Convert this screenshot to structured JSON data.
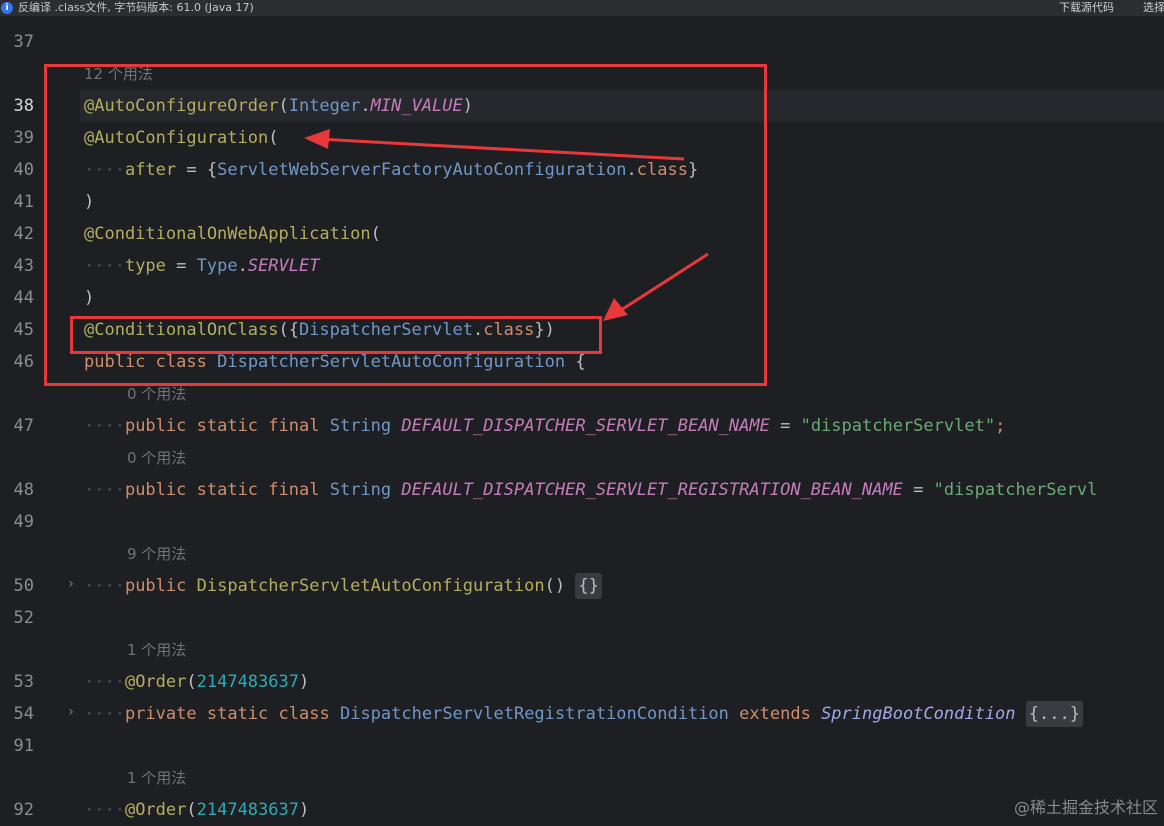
{
  "banner": {
    "message": "反编译 .class文件, 字节码版本: 61.0 (Java 17)",
    "download_source": "下载源代码",
    "choose_source": "选择"
  },
  "editor": {
    "line_numbers": [
      "37",
      "38",
      "39",
      "40",
      "41",
      "42",
      "43",
      "44",
      "45",
      "46",
      "47",
      "48",
      "49",
      "50",
      "52",
      "53",
      "54",
      "91",
      "92"
    ],
    "usages": {
      "l38": "12 个用法",
      "l47": "0 个用法",
      "l48": "0 个用法",
      "l50": "9 个用法",
      "l53": "1 个用法",
      "l92": "1 个用法"
    },
    "tokens": {
      "auto_configure_order": "@AutoConfigureOrder",
      "integer": "Integer",
      "min_value": "MIN_VALUE",
      "auto_configuration": "@AutoConfiguration",
      "after": "after",
      "servlet_web_server_factory": "ServletWebServerFactoryAutoConfiguration",
      "class_kw": "class",
      "conditional_on_web_app": "@ConditionalOnWebApplication",
      "type_param": "type",
      "type_cls": "Type",
      "servlet": "SERVLET",
      "conditional_on_class": "@ConditionalOnClass",
      "dispatcher_servlet": "DispatcherServlet",
      "public_kw": "public",
      "auto_config_class": "DispatcherServletAutoConfiguration",
      "static_kw": "static",
      "final_kw": "final",
      "string_cls": "String",
      "bean_name_const": "DEFAULT_DISPATCHER_SERVLET_BEAN_NAME",
      "dispatcher_servlet_str": "\"dispatcherServlet\"",
      "reg_bean_name_const": "DEFAULT_DISPATCHER_SERVLET_REGISTRATION_BEAN_NAME",
      "dispatcher_servlet_str_cut": "\"dispatcherServl",
      "order_ann": "@Order",
      "order_value": "2147483637",
      "private_kw": "private",
      "registration_condition": "DispatcherServletRegistrationCondition",
      "extends_kw": "extends",
      "spring_boot_condition": "SpringBootCondition",
      "folded_body": "{...}",
      "empty_body": "{}"
    }
  },
  "watermark": "@稀土掘金技术社区",
  "colors": {
    "annotation": "#b3ae60",
    "keyword": "#cf8e6d",
    "class": "#6f98c8",
    "constant": "#c77dbb",
    "string": "#6aab73",
    "number": "#2aacb8",
    "highlight_box": "#e8383b"
  }
}
